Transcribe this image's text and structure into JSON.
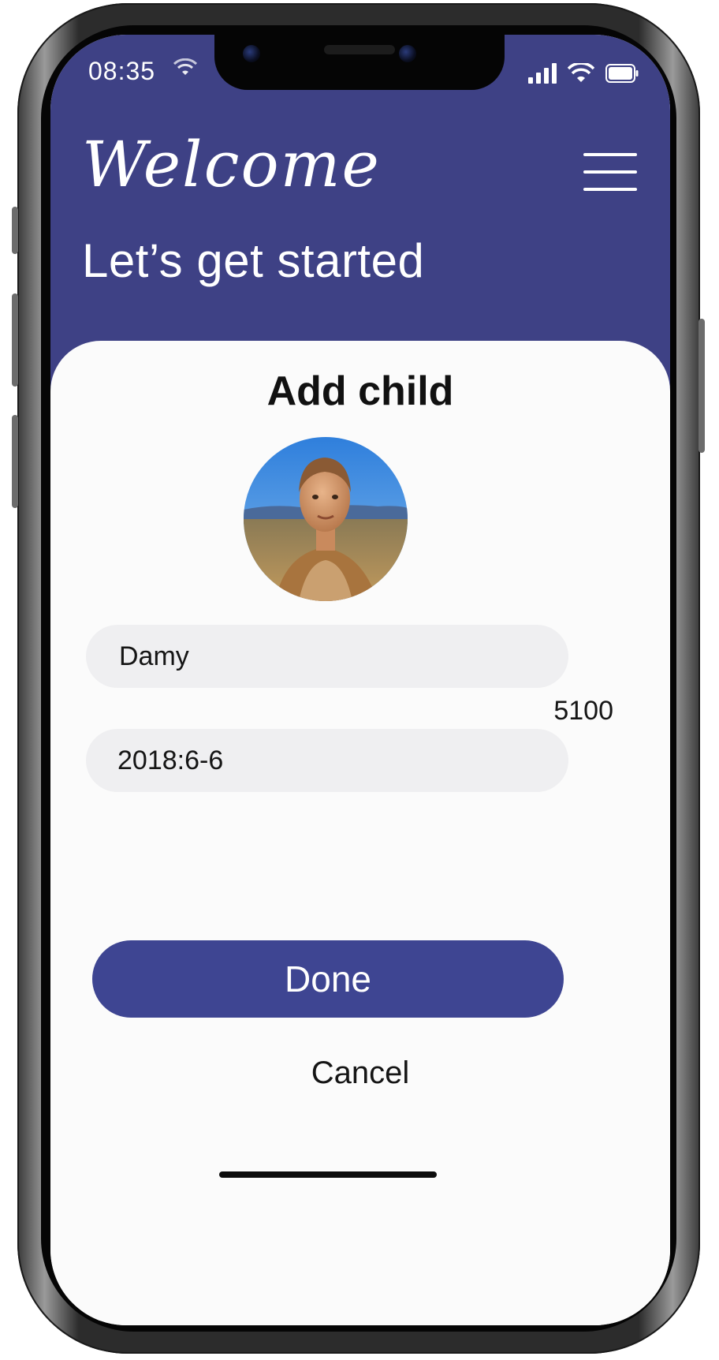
{
  "status_bar": {
    "time": "08:35",
    "icons": [
      "wifi-small-icon",
      "signal-icon",
      "wifi-icon",
      "battery-icon"
    ]
  },
  "header": {
    "script_title": "Welcome",
    "headline": "Let’s get started",
    "menu_icon": "hamburger-menu-icon",
    "background_color": "#3e4185"
  },
  "card": {
    "title": "Add child",
    "avatar": "child-photo",
    "name_value": "Damy",
    "side_number": "5100",
    "date_value": "2018:6-6"
  },
  "actions": {
    "done_label": "Done",
    "cancel_label": "Cancel",
    "accent_color": "#3e4592"
  }
}
